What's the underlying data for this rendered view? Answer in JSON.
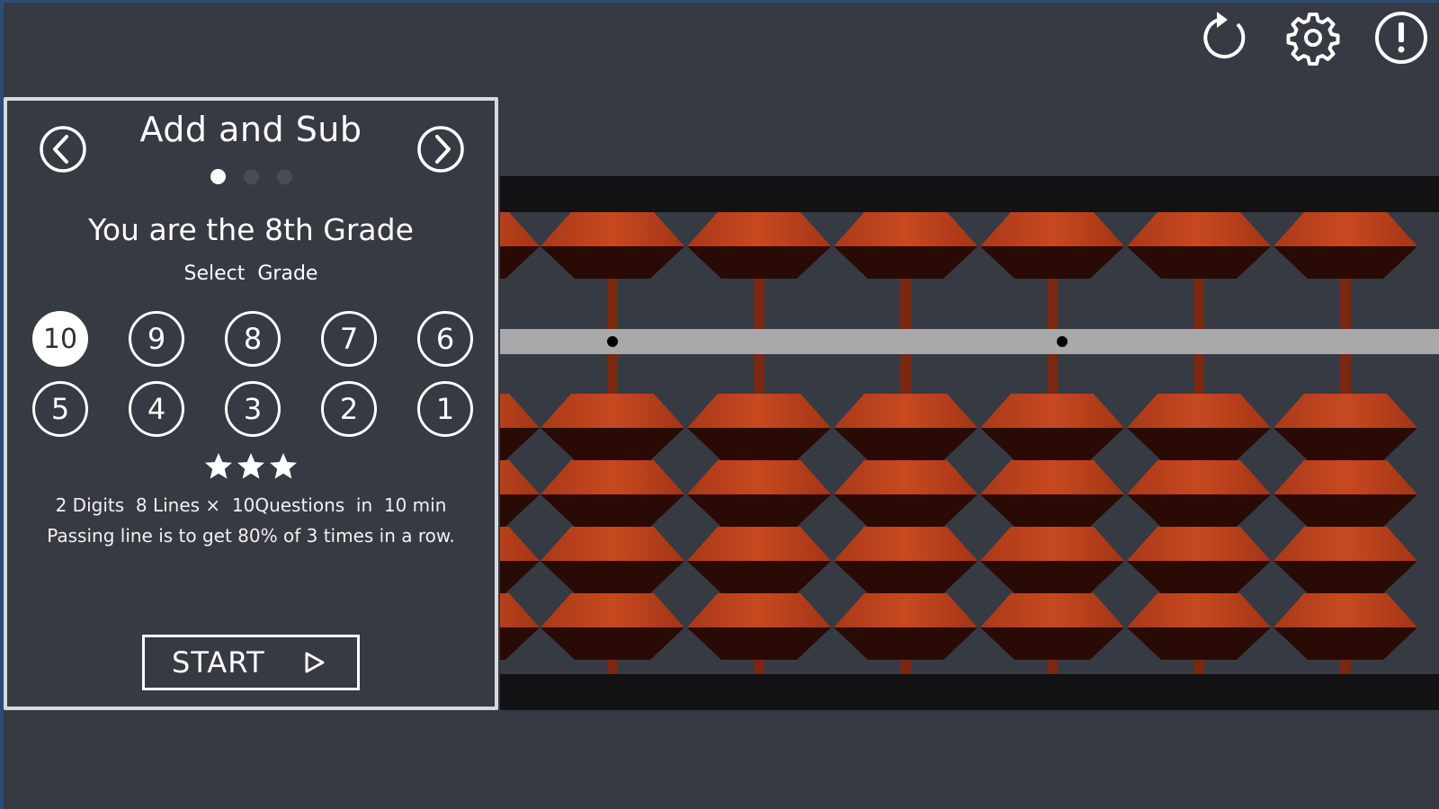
{
  "toolbar": {
    "reset_icon": "reset-icon",
    "settings_icon": "gear-icon",
    "info_icon": "info-icon"
  },
  "panel": {
    "title": "Add and Sub",
    "page_count": 3,
    "page_index": 0,
    "grade_heading": "You are the 8th Grade",
    "grade_subheading": "Select  Grade",
    "grades": [
      "10",
      "9",
      "8",
      "7",
      "6",
      "5",
      "4",
      "3",
      "2",
      "1"
    ],
    "selected_grade": "10",
    "stars": 3,
    "info_line_1": "2 Digits  8 Lines ×  10Questions  in  10 min",
    "info_line_2": "Passing line is to get 80% of 3 times in a row.",
    "start_label": "START"
  },
  "colors": {
    "background": "#363a42",
    "bead_light": "#c0461f",
    "bead_dark": "#2a0a04",
    "frame": "#121214",
    "beam": "#a9a9ab"
  }
}
